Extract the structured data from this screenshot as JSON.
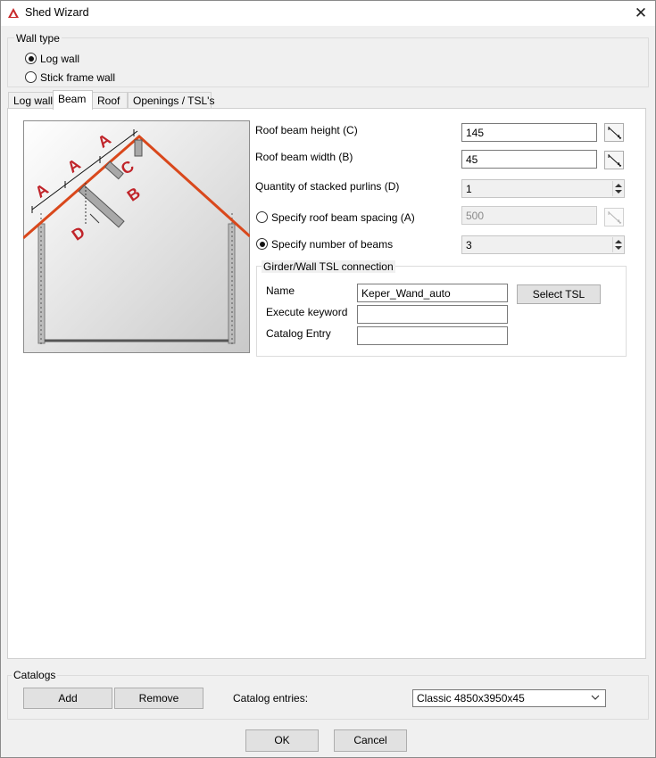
{
  "window": {
    "title": "Shed Wizard",
    "close_glyph": "✕"
  },
  "wall_type": {
    "legend": "Wall type",
    "options": [
      {
        "label": "Log wall",
        "checked": true
      },
      {
        "label": "Stick frame wall",
        "checked": false
      }
    ]
  },
  "tabs": [
    {
      "label": "Log wall",
      "active": false
    },
    {
      "label": "Beam",
      "active": true
    },
    {
      "label": "Roof",
      "active": false
    },
    {
      "label": "Openings / TSL's",
      "active": false
    }
  ],
  "diagram": {
    "labels": [
      "A",
      "A",
      "A",
      "B",
      "C",
      "D"
    ]
  },
  "beam": {
    "height_label": "Roof beam height (C)",
    "height_value": "145",
    "width_label": "Roof beam width (B)",
    "width_value": "45",
    "purlins_label": "Quantity of stacked purlins (D)",
    "purlins_value": "1",
    "spacing_label": "Specify roof beam spacing (A)",
    "spacing_value": "500",
    "spacing_checked": false,
    "number_label": "Specify number of beams",
    "number_value": "3",
    "number_checked": true
  },
  "tsl": {
    "legend": "Girder/Wall TSL connection",
    "name_label": "Name",
    "name_value": "Keper_Wand_auto",
    "select_label": "Select TSL",
    "keyword_label": "Execute keyword",
    "keyword_value": "",
    "catalog_label": "Catalog Entry",
    "catalog_value": ""
  },
  "catalogs": {
    "legend": "Catalogs",
    "add_label": "Add",
    "remove_label": "Remove",
    "entries_label": "Catalog entries:",
    "selected": "Classic 4850x3950x45"
  },
  "footer": {
    "ok_label": "OK",
    "cancel_label": "Cancel"
  },
  "colors": {
    "roof": "#d9481c",
    "label": "#c0242a",
    "beam": "#9a9a9a"
  }
}
